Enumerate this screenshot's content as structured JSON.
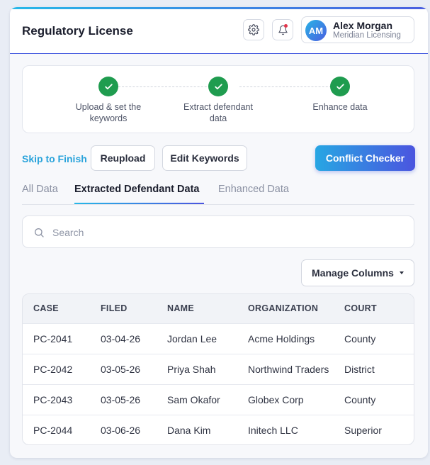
{
  "header": {
    "title": "Regulatory License",
    "user": {
      "initials": "AM",
      "name": "Alex Morgan",
      "org": "Meridian Licensing"
    }
  },
  "stepper": {
    "steps": [
      {
        "label": "Upload & set the keywords",
        "done": true
      },
      {
        "label": "Extract defendant data",
        "done": true
      },
      {
        "label": "Enhance data",
        "done": true
      }
    ]
  },
  "actions": {
    "skip": "Skip to Finish",
    "reupload": "Reupload",
    "edit_keywords": "Edit Keywords",
    "conflict_checker": "Conflict Checker"
  },
  "tabs": [
    {
      "label": "All Data",
      "active": false
    },
    {
      "label": "Extracted Defendant Data",
      "active": true
    },
    {
      "label": "Enhanced Data",
      "active": false
    }
  ],
  "search": {
    "placeholder": "Search",
    "value": ""
  },
  "manage_columns": "Manage Columns",
  "table": {
    "columns": [
      "CASE",
      "FILED",
      "NAME",
      "ORGANIZATION",
      "COURT"
    ],
    "rows": [
      [
        "PC-2041",
        "03-04-26",
        "Jordan Lee",
        "Acme Holdings",
        "County"
      ],
      [
        "PC-2042",
        "03-05-26",
        "Priya Shah",
        "Northwind Traders",
        "District"
      ],
      [
        "PC-2043",
        "03-05-26",
        "Sam Okafor",
        "Globex Corp",
        "County"
      ],
      [
        "PC-2044",
        "03-06-26",
        "Dana Kim",
        "Initech LLC",
        "Superior"
      ]
    ]
  },
  "colors": {
    "accent_start": "#27b8e8",
    "accent_end": "#4b55df",
    "success": "#1f9c4f",
    "link": "#29a3db",
    "notification": "#e2364b"
  }
}
